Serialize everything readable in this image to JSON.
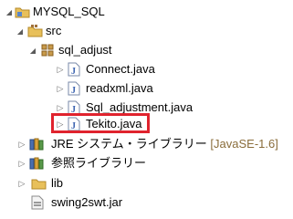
{
  "tree": {
    "project": {
      "label": "MYSQL_SQL",
      "icon": "project-folder-icon",
      "expanded": true
    },
    "src": {
      "label": "src",
      "icon": "source-folder-icon",
      "expanded": true
    },
    "package": {
      "label": "sql_adjust",
      "icon": "package-icon",
      "expanded": true
    },
    "files": [
      {
        "label": "Connect.java",
        "icon": "java-file-icon"
      },
      {
        "label": "readxml.java",
        "icon": "java-file-icon"
      },
      {
        "label": "Sql_adjustment.java",
        "icon": "java-file-icon"
      },
      {
        "label": "Tekito.java",
        "icon": "java-file-icon",
        "highlighted": true
      }
    ],
    "jre": {
      "label": "JRE システム・ライブラリー",
      "suffix": "[JavaSE-1.6]",
      "icon": "library-icon"
    },
    "refs": {
      "label": "参照ライブラリー",
      "icon": "library-icon"
    },
    "lib": {
      "label": "lib",
      "icon": "folder-icon"
    },
    "jar": {
      "label": "swing2swt.jar",
      "icon": "jar-file-icon"
    }
  },
  "colors": {
    "highlight_border": "#e0232e",
    "folder": "#e8c05a",
    "java_icon_blue": "#3a62b0",
    "suffix": "#8a6d3b"
  }
}
